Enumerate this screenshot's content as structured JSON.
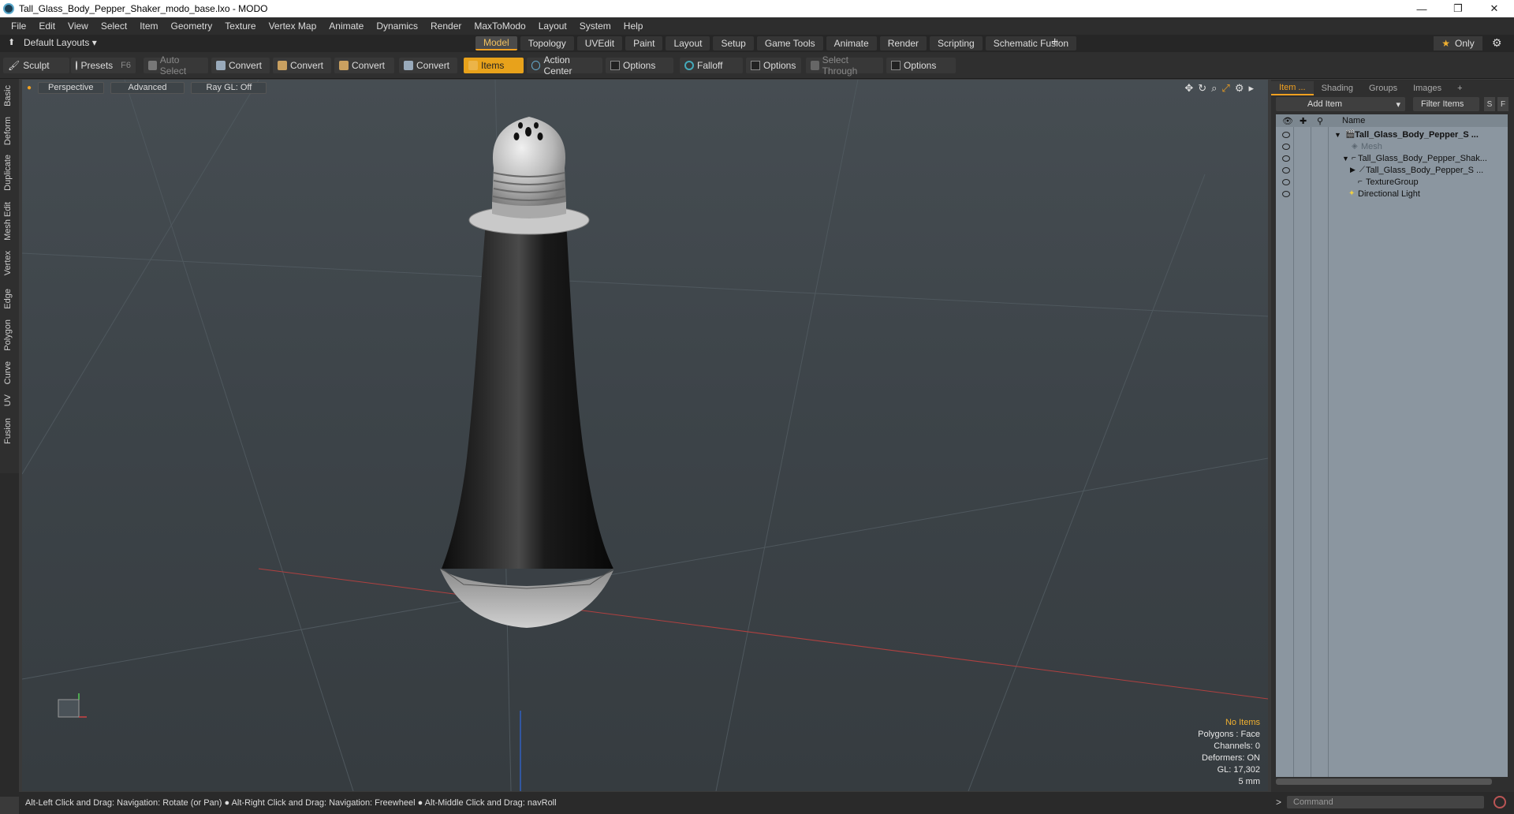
{
  "window": {
    "title": "Tall_Glass_Body_Pepper_Shaker_modo_base.lxo - MODO",
    "minimize": "—",
    "maximize": "❐",
    "close": "✕"
  },
  "menu": [
    "File",
    "Edit",
    "View",
    "Select",
    "Item",
    "Geometry",
    "Texture",
    "Vertex Map",
    "Animate",
    "Dynamics",
    "Render",
    "MaxToModo",
    "Layout",
    "System",
    "Help"
  ],
  "layoutbar": {
    "layouts_label": "Default Layouts ▾",
    "tabs": [
      "Model",
      "Topology",
      "UVEdit",
      "Paint",
      "Layout",
      "Setup",
      "Game Tools",
      "Animate",
      "Render",
      "Scripting",
      "Schematic Fusion"
    ],
    "active_tab": "Model",
    "only_label": "Only"
  },
  "toolbar": {
    "sculpt": "Sculpt",
    "presets": "Presets",
    "presets_key": "F6",
    "auto_select": "Auto Select",
    "convert1": "Convert",
    "convert2": "Convert",
    "convert3": "Convert",
    "convert4": "Convert",
    "items": "Items",
    "action_center": "Action Center",
    "options1": "Options",
    "falloff": "Falloff",
    "options2": "Options",
    "select_through": "Select Through",
    "options3": "Options"
  },
  "left_tabs": [
    "Basic",
    "Deform",
    "Duplicate",
    "Mesh Edit",
    "Vertex",
    "Edge",
    "Polygon",
    "Curve",
    "UV",
    "Fusion"
  ],
  "viewport": {
    "view_mode": "Perspective",
    "shading": "Advanced",
    "raygl": "Ray GL: Off",
    "info": {
      "selection": "No Items",
      "polygons": "Polygons : Face",
      "channels": "Channels: 0",
      "deformers": "Deformers: ON",
      "gl": "GL: 17,302",
      "scale": "5 mm"
    }
  },
  "right_panel": {
    "tabs": [
      "Item ...",
      "Shading",
      "Groups",
      "Images"
    ],
    "active_tab": "Item ...",
    "add_item": "Add Item",
    "filter_items": "Filter Items",
    "s_btn": "S",
    "f_btn": "F",
    "name_col": "Name",
    "tree": [
      {
        "label": "Tall_Glass_Body_Pepper_S ...",
        "style": "bold"
      },
      {
        "label": "Mesh",
        "style": "dim"
      },
      {
        "label": "Tall_Glass_Body_Pepper_Shak...",
        "style": "normal"
      },
      {
        "label": "Tall_Glass_Body_Pepper_S ...",
        "style": "normal"
      },
      {
        "label": "TextureGroup",
        "style": "normal"
      },
      {
        "label": "Directional Light",
        "style": "normal"
      }
    ]
  },
  "status": {
    "hint": "Alt-Left Click and Drag: Navigation: Rotate (or Pan) ● Alt-Right Click and Drag: Navigation: Freewheel ● Alt-Middle Click and Drag: navRoll",
    "command_placeholder": "Command"
  },
  "colors": {
    "accent": "#f0a020",
    "viewport_bg": "#3d4449",
    "tree_bg": "#8b96a0"
  }
}
